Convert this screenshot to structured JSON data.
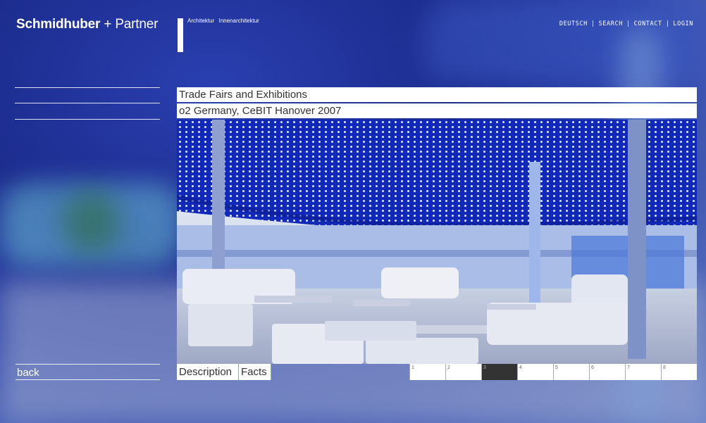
{
  "brand": {
    "name_bold": "Schmidhuber",
    "plus": "+",
    "name_regular": "Partner"
  },
  "tagline": {
    "item1": "Architektur",
    "item2": "Innenarchitektur"
  },
  "topnav": [
    {
      "label": "DEUTSCH"
    },
    {
      "label": "SEARCH"
    },
    {
      "label": "CONTACT"
    },
    {
      "label": "LOGIN"
    }
  ],
  "content": {
    "category": "Trade Fairs and Exhibitions",
    "project": "o2 Germany, CeBIT Hanover 2007"
  },
  "tabs": {
    "description": "Description",
    "facts": "Facts"
  },
  "pager": {
    "pages": [
      "1",
      "2",
      "3",
      "4",
      "5",
      "6",
      "7",
      "8"
    ],
    "active": 3
  },
  "back_label": "back",
  "colors": {
    "background": "#1c2c8e",
    "active_page": "#333333"
  }
}
